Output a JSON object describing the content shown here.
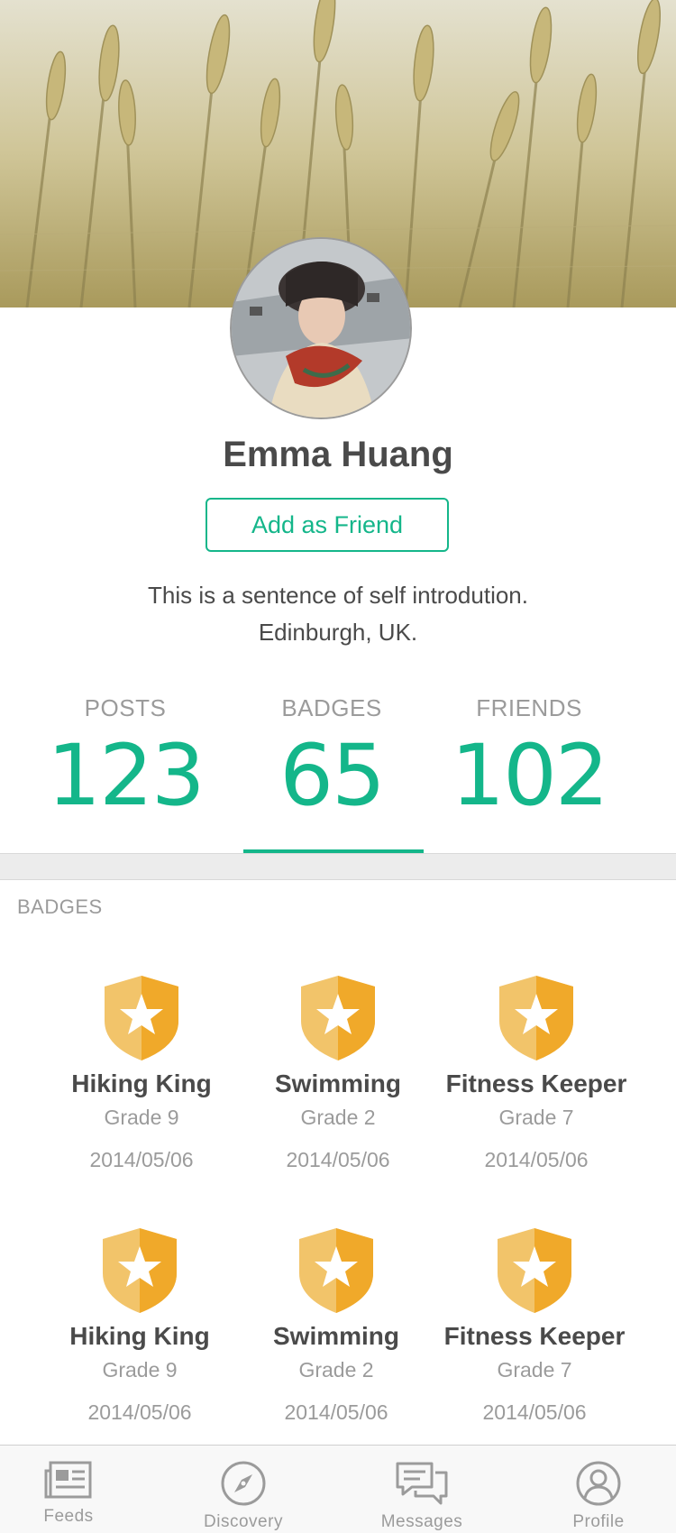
{
  "profile": {
    "name": "Emma Huang",
    "add_friend_label": "Add as Friend",
    "intro_line1": "This is a sentence of self introdution.",
    "intro_line2": "Edinburgh, UK."
  },
  "stats": [
    {
      "label": "POSTS",
      "value": "123"
    },
    {
      "label": "BADGES",
      "value": "65"
    },
    {
      "label": "FRIENDS",
      "value": "102"
    }
  ],
  "active_stat": "BADGES",
  "badges_section": {
    "title": "BADGES",
    "items": [
      {
        "name": "Hiking King",
        "grade": "Grade 9",
        "date": "2014/05/06",
        "icon": "shield-star-icon"
      },
      {
        "name": "Swimming",
        "grade": "Grade 2",
        "date": "2014/05/06",
        "icon": "shield-star-icon"
      },
      {
        "name": "Fitness Keeper",
        "grade": "Grade 7",
        "date": "2014/05/06",
        "icon": "shield-star-icon"
      },
      {
        "name": "Hiking King",
        "grade": "Grade 9",
        "date": "2014/05/06",
        "icon": "shield-star-icon"
      },
      {
        "name": "Swimming",
        "grade": "Grade 2",
        "date": "2014/05/06",
        "icon": "shield-star-icon"
      },
      {
        "name": "Fitness Keeper",
        "grade": "Grade 7",
        "date": "2014/05/06",
        "icon": "shield-star-icon"
      }
    ]
  },
  "tabbar": {
    "items": [
      {
        "label": "Feeds",
        "icon": "newspaper-icon"
      },
      {
        "label": "Discovery",
        "icon": "compass-icon"
      },
      {
        "label": "Messages",
        "icon": "chat-bubbles-icon"
      },
      {
        "label": "Profile",
        "icon": "user-circle-icon"
      }
    ]
  },
  "colors": {
    "accent": "#14b68a",
    "text": "#4a4a4a",
    "muted": "#9b9b9b",
    "badge_light": "#f2c46a",
    "badge_dark": "#f0a92a"
  }
}
